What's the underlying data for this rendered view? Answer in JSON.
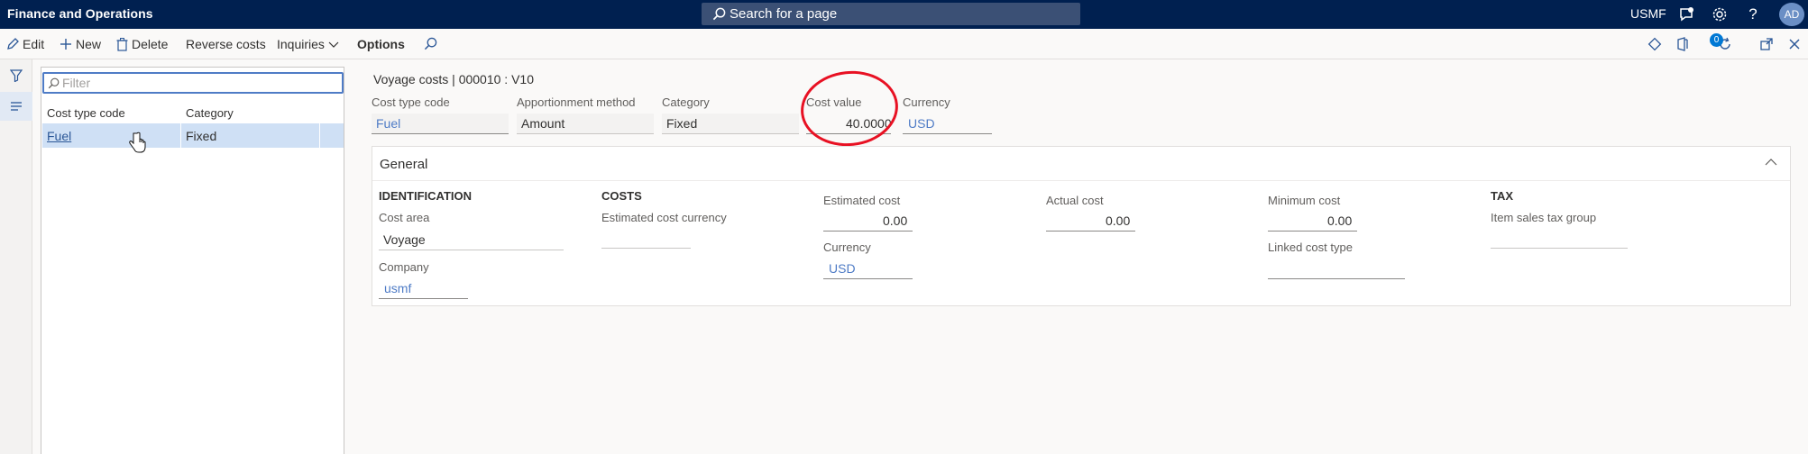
{
  "app": {
    "title": "Finance and Operations"
  },
  "topbar": {
    "search_label": "Search for a page",
    "company": "USMF",
    "avatar_initials": "AD",
    "icons": [
      "chat-icon",
      "gear-icon",
      "help-icon"
    ]
  },
  "actions": {
    "edit": "Edit",
    "new": "New",
    "delete": "Delete",
    "reverse_costs": "Reverse costs",
    "inquiries": "Inquiries",
    "options": "Options",
    "notifications_count": "0"
  },
  "list": {
    "filter_placeholder": "Filter",
    "columns": [
      "Cost type code",
      "Category"
    ],
    "rows": [
      {
        "code": "Fuel",
        "category": "Fixed"
      }
    ]
  },
  "detail": {
    "breadcrumb": "Voyage costs  |  000010 : V10",
    "header_fields": {
      "cost_type_code": {
        "label": "Cost type code",
        "value": "Fuel"
      },
      "apportionment_method": {
        "label": "Apportionment method",
        "value": "Amount"
      },
      "category": {
        "label": "Category",
        "value": "Fixed"
      },
      "cost_value": {
        "label": "Cost value",
        "value": "40.0000"
      },
      "currency": {
        "label": "Currency",
        "value": "USD"
      }
    },
    "general": {
      "title": "General",
      "identification": {
        "title": "IDENTIFICATION",
        "cost_area_label": "Cost area",
        "cost_area_value": "Voyage",
        "company_label": "Company",
        "company_value": "usmf"
      },
      "costs": {
        "title": "COSTS",
        "estimated_cost_currency_label": "Estimated cost currency",
        "estimated_cost_label": "Estimated cost",
        "estimated_cost_value": "0.00",
        "currency_label": "Currency",
        "currency_value": "USD",
        "actual_cost_label": "Actual cost",
        "actual_cost_value": "0.00",
        "minimum_cost_label": "Minimum cost",
        "minimum_cost_value": "0.00",
        "linked_cost_type_label": "Linked cost type"
      },
      "tax": {
        "title": "TAX",
        "item_sales_tax_group_label": "Item sales tax group"
      }
    }
  },
  "colors": {
    "topbar": "#002050",
    "accent": "#2b5797",
    "selection": "#cfe0f5",
    "annotation": "#e81123"
  }
}
